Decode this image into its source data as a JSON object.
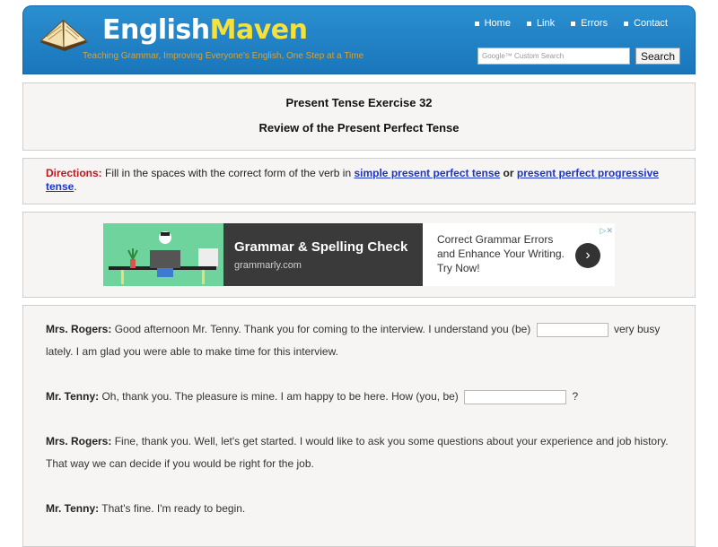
{
  "header": {
    "logo_part1": "English",
    "logo_part2": "Maven",
    "tagline": "Teaching Grammar, Improving Everyone's English, One Step at a Time",
    "nav": [
      "Home",
      "Link",
      "Errors",
      "Contact"
    ],
    "search_placeholder": "Google™ Custom Search",
    "search_button": "Search"
  },
  "title": {
    "line1": "Present Tense Exercise 32",
    "line2": "Review of the Present Perfect Tense"
  },
  "directions": {
    "label": "Directions:",
    "text1": " Fill in the spaces with the correct form of the verb in ",
    "link1": "simple present perfect tense",
    "or": " or ",
    "link2": "present perfect progressive tense",
    "end": "."
  },
  "ad": {
    "headline": "Grammar & Spelling Check",
    "url": "grammarly.com",
    "body": "Correct Grammar Errors and Enhance Your Writing. Try Now!",
    "arrow_icon": "chevron-right-icon",
    "choice_icon": "adchoices-icon"
  },
  "dialogue": [
    {
      "speaker": "Mrs. Rogers:",
      "before": " Good afternoon Mr. Tenny. Thank you for coming to the interview. I understand you (be) ",
      "after": " very busy lately. I am glad you were able to make time for this interview."
    },
    {
      "speaker": "Mr. Tenny:",
      "before": " Oh, thank you. The pleasure is mine. I am happy to be here. How (you, be) ",
      "after": " ?"
    },
    {
      "speaker": "Mrs. Rogers:",
      "before": " Fine, thank you. Well, let's get started. I would like to ask you some questions about your experience and job history. That way we can decide if you would be right for the job.",
      "after": ""
    },
    {
      "speaker": "Mr. Tenny:",
      "before": " That's fine. I'm ready to begin.",
      "after": ""
    }
  ],
  "colors": {
    "header_blue": "#1a76bb",
    "logo_yellow": "#f6e13a",
    "directions_red": "#c2161b",
    "link_blue": "#1d35c9"
  }
}
